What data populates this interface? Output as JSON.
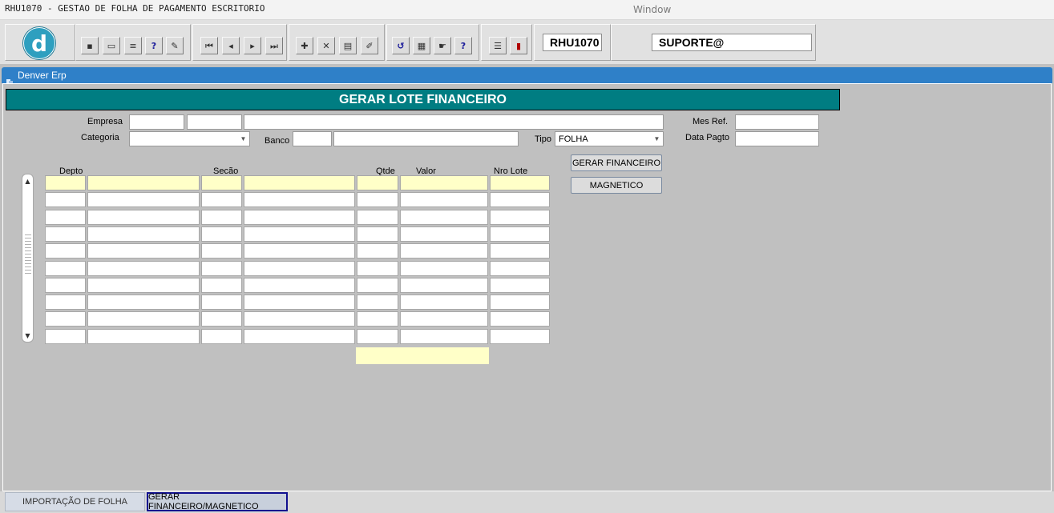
{
  "titlebar": {
    "title": "RHU1070 - GESTAO DE FOLHA DE PAGAMENTO ESCRITORIO",
    "menu_window": "Window"
  },
  "toolbar": {
    "logo_letter": "d",
    "module_code": "RHU1070",
    "user": "SUPORTE@",
    "icons": [
      "save-icon",
      "print-preview-icon",
      "print-icon",
      "query-help-icon",
      "edit-icon",
      "first-record-icon",
      "previous-record-icon",
      "next-record-icon",
      "last-record-icon",
      "insert-record-icon",
      "delete-record-icon",
      "query-icon",
      "clear-icon",
      "undo-icon",
      "clipboard-icon",
      "help-agent-icon",
      "help-icon",
      "menu-icon",
      "exit-icon"
    ]
  },
  "window": {
    "title": "Denver Erp"
  },
  "form": {
    "title": "GERAR LOTE FINANCEIRO",
    "labels": {
      "empresa": "Empresa",
      "categoria": "Categoria",
      "banco": "Banco",
      "tipo": "Tipo",
      "mes_ref": "Mes Ref.",
      "data_pagto": "Data Pagto"
    },
    "values": {
      "tipo": "FOLHA"
    },
    "buttons": {
      "gerar_financeiro": "GERAR FINANCEIRO",
      "magnetico": "MAGNETICO"
    }
  },
  "grid": {
    "headers": {
      "depto": "Depto",
      "secao": "Secão",
      "qtde": "Qtde",
      "valor": "Valor",
      "nro_lote": "Nro Lote"
    },
    "row_count": 10
  },
  "tabs": [
    {
      "label": "IMPORTAÇÃO DE FOLHA",
      "active": false
    },
    {
      "label": "GERAR FINANCEIRO/MAGNETICO",
      "active": true
    }
  ],
  "colors": {
    "form_title_bg": "#007d82",
    "window_header_bg": "#2f80c8",
    "selected_row": "#ffffc8",
    "active_tab_border": "#101090"
  }
}
